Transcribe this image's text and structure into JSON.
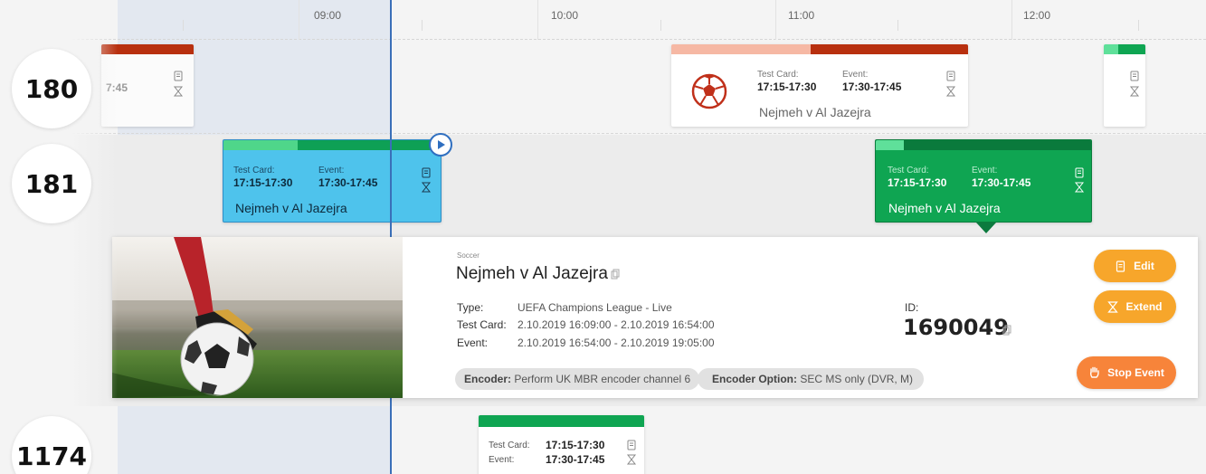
{
  "timeline": {
    "hours": [
      "09:00",
      "10:00",
      "11:00",
      "12:00"
    ]
  },
  "channels": [
    {
      "number": "180"
    },
    {
      "number": "181"
    },
    {
      "number": "1174"
    }
  ],
  "cards": {
    "c180_left": {
      "partial_time": "7:45"
    },
    "c180_mid": {
      "test_card_label": "Test Card:",
      "test_card_time": "17:15-17:30",
      "event_label": "Event:",
      "event_time": "17:30-17:45",
      "title": "Nejmeh v Al Jazejra",
      "colors": {
        "light": "#f6b8a4",
        "dark": "#b8300f"
      }
    },
    "c181_blue": {
      "test_card_label": "Test Card:",
      "test_card_time": "17:15-17:30",
      "event_label": "Event:",
      "event_time": "17:30-17:45",
      "title": "Nejmeh v Al Jazejra",
      "colors": {
        "light": "#4fd68a",
        "dark": "#0ea055",
        "fill": "#4ec3ec"
      }
    },
    "c181_green": {
      "test_card_label": "Test Card:",
      "test_card_time": "17:15-17:30",
      "event_label": "Event:",
      "event_time": "17:30-17:45",
      "title": "Nejmeh v Al Jazejra",
      "colors": {
        "light": "#5fe09a",
        "dark": "#0a7a3c",
        "fill": "#0fa552"
      }
    },
    "c1174": {
      "test_card_label": "Test Card:",
      "test_card_time": "17:15-17:30",
      "event_label": "Event:",
      "event_time": "17:30-17:45"
    }
  },
  "detail": {
    "sport": "Soccer",
    "title": "Nejmeh v Al Jazejra",
    "type_label": "Type:",
    "type_value": "UEFA Champions League - Live",
    "test_card_label": "Test Card:",
    "test_card_value": "2.10.2019 16:09:00 - 2.10.2019 16:54:00",
    "event_label": "Event:",
    "event_value": "2.10.2019 16:54:00 - 2.10.2019 19:05:00",
    "id_label": "ID:",
    "id_value": "1690049",
    "encoder_label": "Encoder:",
    "encoder_value": "Perform UK MBR encoder channel 6",
    "encoder_option_label": "Encoder Option:",
    "encoder_option_value": "SEC MS only (DVR, M)",
    "buttons": {
      "edit": "Edit",
      "extend": "Extend",
      "stop": "Stop Event"
    }
  },
  "icons": [
    "play-icon",
    "edit-icon",
    "extend-icon",
    "stop-hand-icon",
    "copy-icon",
    "soccer-ball-icon"
  ],
  "accent_colors": {
    "now_line": "#3a6fb8",
    "button": "#f7a62b",
    "stop_button": "#f7843a"
  }
}
